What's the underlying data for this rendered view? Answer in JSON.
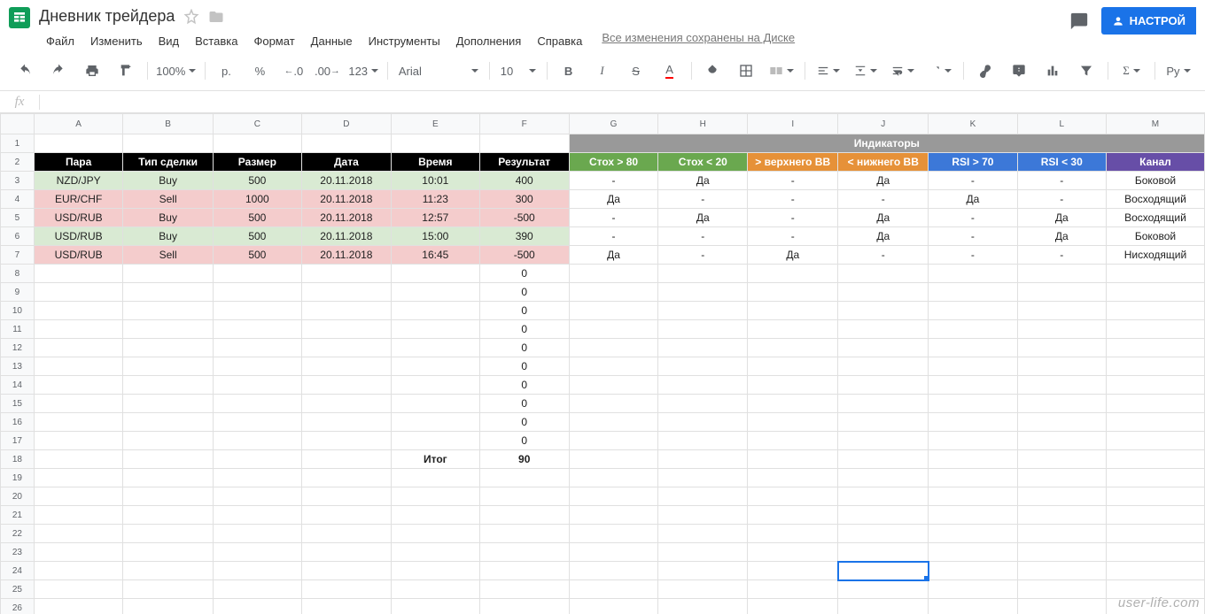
{
  "doc": {
    "title": "Дневник трейдера"
  },
  "menu": [
    "Файл",
    "Изменить",
    "Вид",
    "Вставка",
    "Формат",
    "Данные",
    "Инструменты",
    "Дополнения",
    "Справка"
  ],
  "saved_msg": "Все изменения сохранены на Диске",
  "share_label": "НАСТРОЙ",
  "toolbar": {
    "zoom": "100%",
    "currency": "р.",
    "pct": "%",
    "dec0": ".0",
    "dec00": ".00",
    "num": "123",
    "font": "Arial",
    "size": "10",
    "bold": "B",
    "italic": "I",
    "strike": "S",
    "color": "A",
    "py": "Py"
  },
  "columns": [
    "A",
    "B",
    "C",
    "D",
    "E",
    "F",
    "G",
    "H",
    "I",
    "J",
    "K",
    "L",
    "M"
  ],
  "headers1": {
    "indicators": "Индикаторы"
  },
  "headers2": {
    "pair": "Пара",
    "type": "Тип сделки",
    "size": "Размер",
    "date": "Дата",
    "time": "Время",
    "result": "Результат",
    "stoch80": "Стох > 80",
    "stoch20": "Стох < 20",
    "bbup": "> верхнего BB",
    "bbdn": "< нижнего BB",
    "rsi70": "RSI > 70",
    "rsi30": "RSI < 30",
    "channel": "Канал"
  },
  "trades": [
    {
      "kind": "buy",
      "pair": "NZD/JPY",
      "type": "Buy",
      "size": "500",
      "date": "20.11.2018",
      "time": "10:01",
      "res": "400",
      "i": [
        "-",
        "Да",
        "-",
        "Да",
        "-",
        "-",
        "Боковой"
      ]
    },
    {
      "kind": "sell",
      "pair": "EUR/CHF",
      "type": "Sell",
      "size": "1000",
      "date": "20.11.2018",
      "time": "11:23",
      "res": "300",
      "i": [
        "Да",
        "-",
        "-",
        "-",
        "Да",
        "-",
        "Восходящий"
      ]
    },
    {
      "kind": "sell",
      "pair": "USD/RUB",
      "type": "Buy",
      "size": "500",
      "date": "20.11.2018",
      "time": "12:57",
      "res": "-500",
      "i": [
        "-",
        "Да",
        "-",
        "Да",
        "-",
        "Да",
        "Восходящий"
      ]
    },
    {
      "kind": "buy",
      "pair": "USD/RUB",
      "type": "Buy",
      "size": "500",
      "date": "20.11.2018",
      "time": "15:00",
      "res": "390",
      "i": [
        "-",
        "-",
        "-",
        "Да",
        "-",
        "Да",
        "Боковой"
      ]
    },
    {
      "kind": "sell",
      "pair": "USD/RUB",
      "type": "Sell",
      "size": "500",
      "date": "20.11.2018",
      "time": "16:45",
      "res": "-500",
      "i": [
        "Да",
        "-",
        "Да",
        "-",
        "-",
        "-",
        "Нисходящий"
      ]
    }
  ],
  "zeros_rows": 10,
  "total": {
    "label": "Итог",
    "value": "90"
  },
  "row_count": 26,
  "active_cell": {
    "row": 24,
    "col": "J"
  },
  "watermark": "user-life.com"
}
